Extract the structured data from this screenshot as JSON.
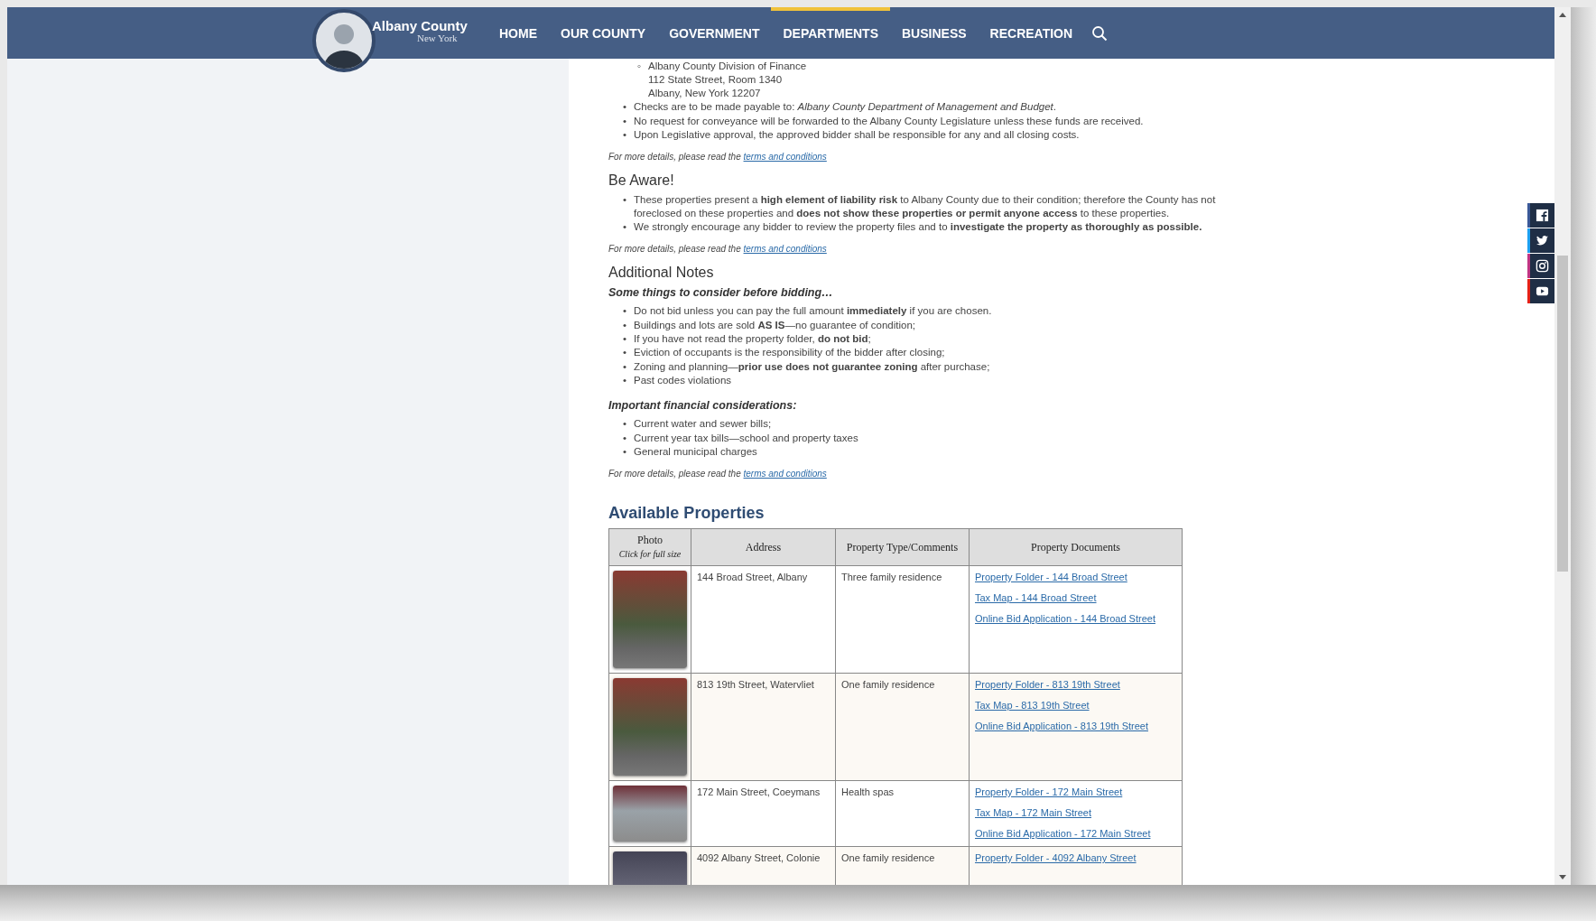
{
  "header": {
    "brand": {
      "name": "Albany County",
      "subtitle": "New York"
    },
    "nav": [
      {
        "label": "HOME",
        "selected": false
      },
      {
        "label": "OUR COUNTY",
        "selected": false
      },
      {
        "label": "GOVERNMENT",
        "selected": false
      },
      {
        "label": "DEPARTMENTS",
        "selected": true
      },
      {
        "label": "BUSINESS",
        "selected": false
      },
      {
        "label": "RECREATION",
        "selected": false
      }
    ]
  },
  "social": [
    {
      "kind": "facebook",
      "color": "#3b5998"
    },
    {
      "kind": "twitter",
      "color": "#1da1f2"
    },
    {
      "kind": "instagram",
      "color": "#c13584"
    },
    {
      "kind": "youtube",
      "color": "#e62117"
    }
  ],
  "payment": {
    "address": {
      "marker": "◦",
      "lines": [
        "Albany County Division of Finance",
        "112 State Street, Room 1340",
        "Albany, New York 12207"
      ]
    },
    "bullets": {
      "marker": "•",
      "items": [
        "Checks are to be made payable to: *Albany County Department of Management and Budget*.",
        "No request for conveyance will be forwarded to the Albany County Legislature unless these funds are received.",
        "Upon Legislative approval, the approved bidder shall be responsible for any and all closing costs."
      ]
    },
    "note": {
      "text": "For more details, please read the",
      "link": "terms and conditions"
    }
  },
  "be_aware": {
    "title": "Be Aware!",
    "bullets": {
      "marker": "•",
      "items": [
        "These properties present a **high element of liability risk** to Albany County due to their condition; therefore the County has not foreclosed on these properties and **does not show these properties or permit anyone access** to these properties.",
        "We strongly encourage any bidder to review the property files and to **investigate the property as thoroughly as possible.**"
      ]
    },
    "note": {
      "text": "For more details, please read the",
      "link": "terms and conditions"
    }
  },
  "additional_notes": {
    "title": "Additional Notes",
    "groups": [
      {
        "subtitle": "Some things to consider before bidding…",
        "bullets": {
          "marker": "•",
          "items": [
            "Do not bid unless you can pay the full amount **immediately** if you are chosen.",
            "Buildings and lots are sold **AS IS**—no guarantee of condition;",
            "If you have not read the property folder, **do not bid**;",
            "Eviction of occupants is the responsibility of the bidder after closing;",
            "Zoning and planning—**prior use does not guarantee zoning** after purchase;",
            "Past codes violations"
          ]
        }
      },
      {
        "subtitle": "Important financial considerations:",
        "bullets": {
          "marker": "•",
          "items": [
            "Current water and sewer bills;",
            "Current year tax bills—school and property taxes",
            "General municipal charges"
          ]
        }
      }
    ],
    "note": {
      "text": "For more details, please read the",
      "link": "terms and conditions"
    }
  },
  "properties": {
    "title": "Available Properties",
    "columns": [
      {
        "label": "Photo",
        "sublabel": "Click for full size"
      },
      {
        "label": "Address"
      },
      {
        "label": "Property Type/Comments"
      },
      {
        "label": "Property Documents"
      }
    ],
    "rows": [
      {
        "kind": "portrait",
        "address": "144 Broad Street, Albany",
        "type": "Three family residence",
        "documents": [
          "Property Folder - 144 Broad Street",
          "Tax Map - 144 Broad Street",
          "Online Bid Application - 144 Broad Street"
        ]
      },
      {
        "kind": "portrait",
        "address": "813 19th Street, Watervliet",
        "type": "One family residence",
        "documents": [
          "Property Folder - 813 19th Street",
          "Tax Map - 813 19th Street",
          "Online Bid Application - 813 19th Street"
        ]
      },
      {
        "kind": "landscape",
        "address": "172 Main Street, Coeymans",
        "type": "Health spas",
        "documents": [
          "Property Folder - 172 Main Street",
          "Tax Map - 172 Main Street",
          "Online Bid Application - 172 Main Street"
        ]
      },
      {
        "kind": "cut",
        "address": "4092 Albany Street, Colonie",
        "type": "One family residence",
        "documents": [
          "Property Folder - 4092 Albany Street"
        ]
      }
    ]
  }
}
